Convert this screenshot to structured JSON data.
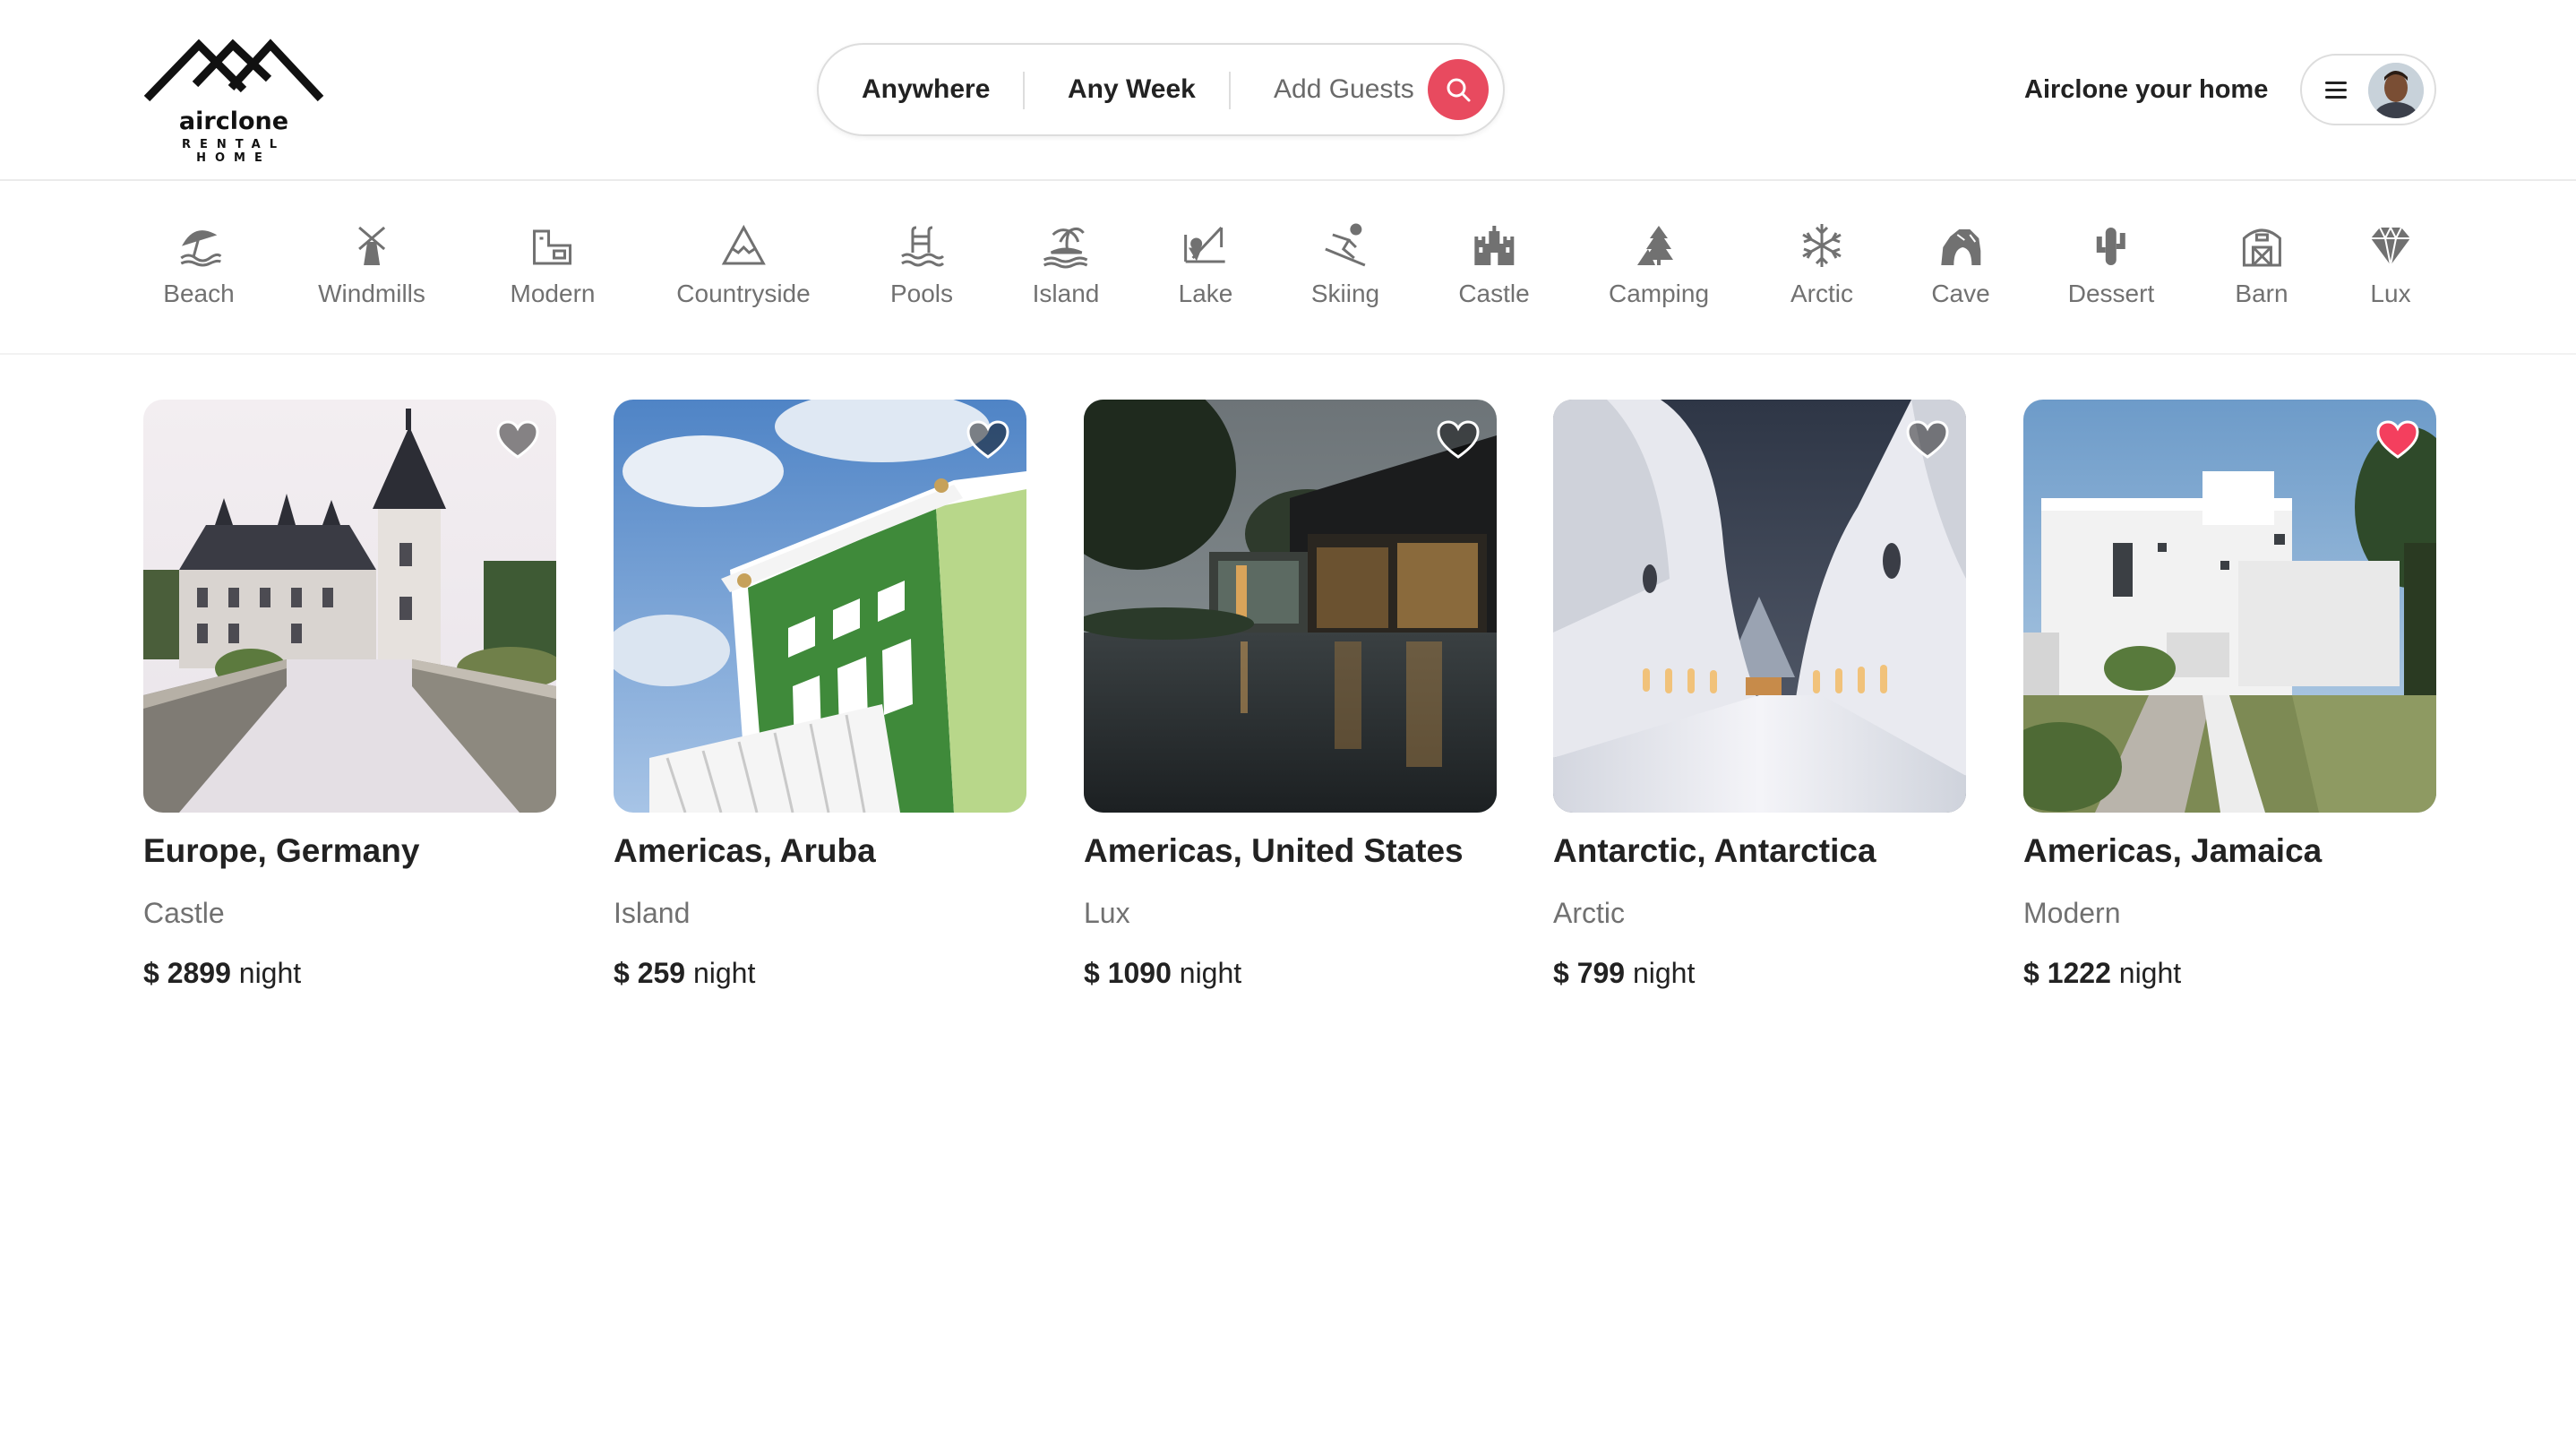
{
  "brand": {
    "name": "airclone",
    "tagline": "RENTAL HOME"
  },
  "search": {
    "location": "Anywhere",
    "dates": "Any Week",
    "guests": "Add Guests",
    "button_icon": "search-icon"
  },
  "header": {
    "host_link": "Airclone your home",
    "menu_icon": "hamburger-icon"
  },
  "categories": [
    {
      "label": "Beach",
      "icon": "beach-icon"
    },
    {
      "label": "Windmills",
      "icon": "windmill-icon"
    },
    {
      "label": "Modern",
      "icon": "modern-house-icon"
    },
    {
      "label": "Countryside",
      "icon": "mountain-icon"
    },
    {
      "label": "Pools",
      "icon": "pool-icon"
    },
    {
      "label": "Island",
      "icon": "island-icon"
    },
    {
      "label": "Lake",
      "icon": "lake-fishing-icon"
    },
    {
      "label": "Skiing",
      "icon": "skier-icon"
    },
    {
      "label": "Castle",
      "icon": "castle-icon"
    },
    {
      "label": "Camping",
      "icon": "camping-icon"
    },
    {
      "label": "Arctic",
      "icon": "snowflake-icon"
    },
    {
      "label": "Cave",
      "icon": "cave-icon"
    },
    {
      "label": "Dessert",
      "icon": "cactus-icon"
    },
    {
      "label": "Barn",
      "icon": "barn-icon"
    },
    {
      "label": "Lux",
      "icon": "diamond-icon"
    }
  ],
  "listings": [
    {
      "location": "Europe, Germany",
      "category": "Castle",
      "currency": "$",
      "price": "2899",
      "unit": "night",
      "favorited": false
    },
    {
      "location": "Americas, Aruba",
      "category": "Island",
      "currency": "$",
      "price": "259",
      "unit": "night",
      "favorited": false
    },
    {
      "location": "Americas, United States",
      "category": "Lux",
      "currency": "$",
      "price": "1090",
      "unit": "night",
      "favorited": false
    },
    {
      "location": "Antarctic, Antarctica",
      "category": "Arctic",
      "currency": "$",
      "price": "799",
      "unit": "night",
      "favorited": false
    },
    {
      "location": "Americas, Jamaica",
      "category": "Modern",
      "currency": "$",
      "price": "1222",
      "unit": "night",
      "favorited": true
    }
  ],
  "colors": {
    "accent": "#e84a5f",
    "heart_active": "#f43f5e",
    "muted_text": "#717171"
  }
}
